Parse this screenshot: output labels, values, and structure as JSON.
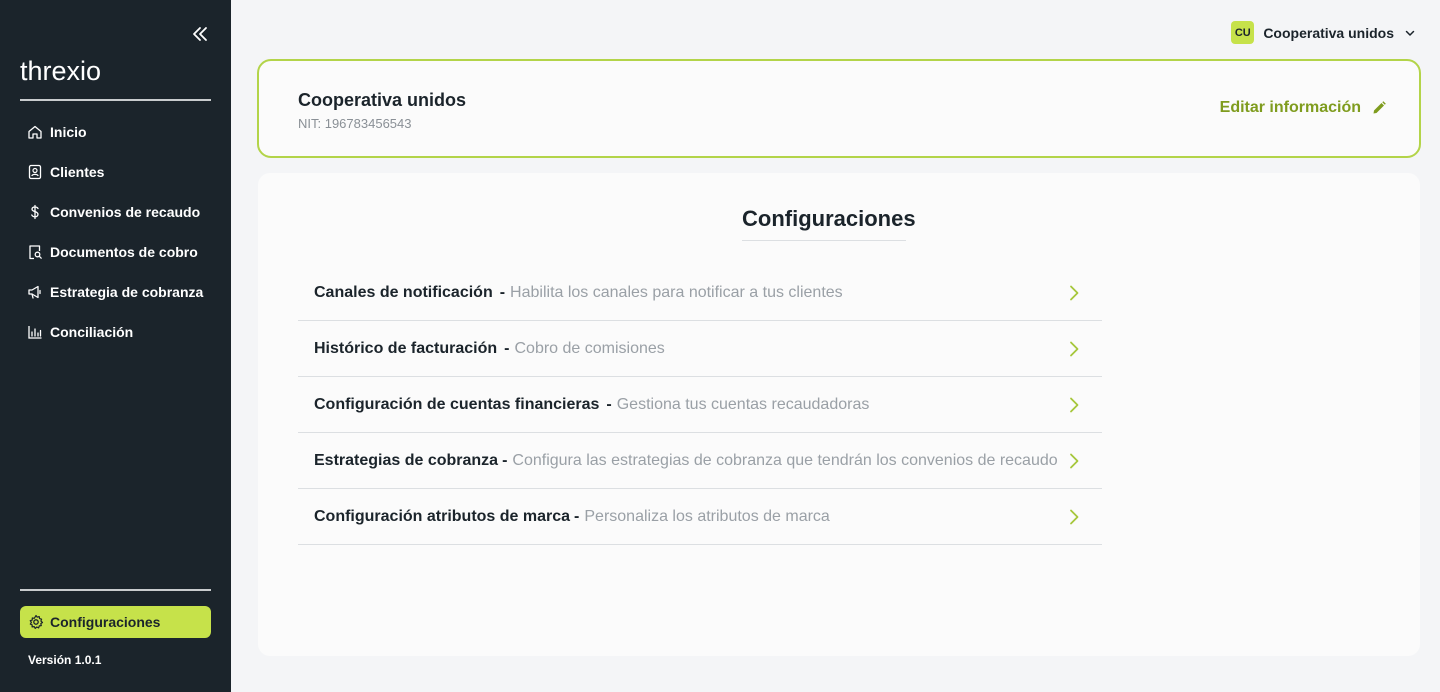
{
  "sidebar": {
    "logo_text": "threxio",
    "items": [
      {
        "label": "Inicio",
        "icon": "home-icon"
      },
      {
        "label": "Clientes",
        "icon": "client-card-icon"
      },
      {
        "label": "Convenios de recaudo",
        "icon": "dollar-icon"
      },
      {
        "label": "Documentos de cobro",
        "icon": "document-search-icon"
      },
      {
        "label": "Estrategia de cobranza",
        "icon": "megaphone-icon"
      },
      {
        "label": "Conciliación",
        "icon": "bar-chart-icon"
      }
    ],
    "active_item": {
      "label": "Configuraciones",
      "icon": "gear-icon"
    },
    "version": "Versión 1.0.1"
  },
  "header": {
    "org_initials": "CU",
    "org_name": "Cooperativa unidos"
  },
  "org_card": {
    "name": "Cooperativa unidos",
    "nit": "NIT: 196783456543",
    "edit_label": "Editar información"
  },
  "settings": {
    "title": "Configuraciones",
    "rows": [
      {
        "title": "Canales de notificación",
        "desc": "Habilita los canales para notificar a tus clientes"
      },
      {
        "title": "Histórico de facturación",
        "desc": "Cobro de comisiones"
      },
      {
        "title": "Configuración de cuentas financieras",
        "desc": "Gestiona tus cuentas recaudadoras"
      },
      {
        "title": "Estrategias de cobranza",
        "desc": "Configura las estrategias de cobranza que tendrán los convenios de recaudo"
      },
      {
        "title": "Configuración atributos de marca",
        "desc": "Personaliza los atributos de marca"
      }
    ]
  },
  "colors": {
    "sidebar_bg": "#1b242b",
    "accent": "#c6e24a",
    "accent_text": "#7f9c1e"
  }
}
